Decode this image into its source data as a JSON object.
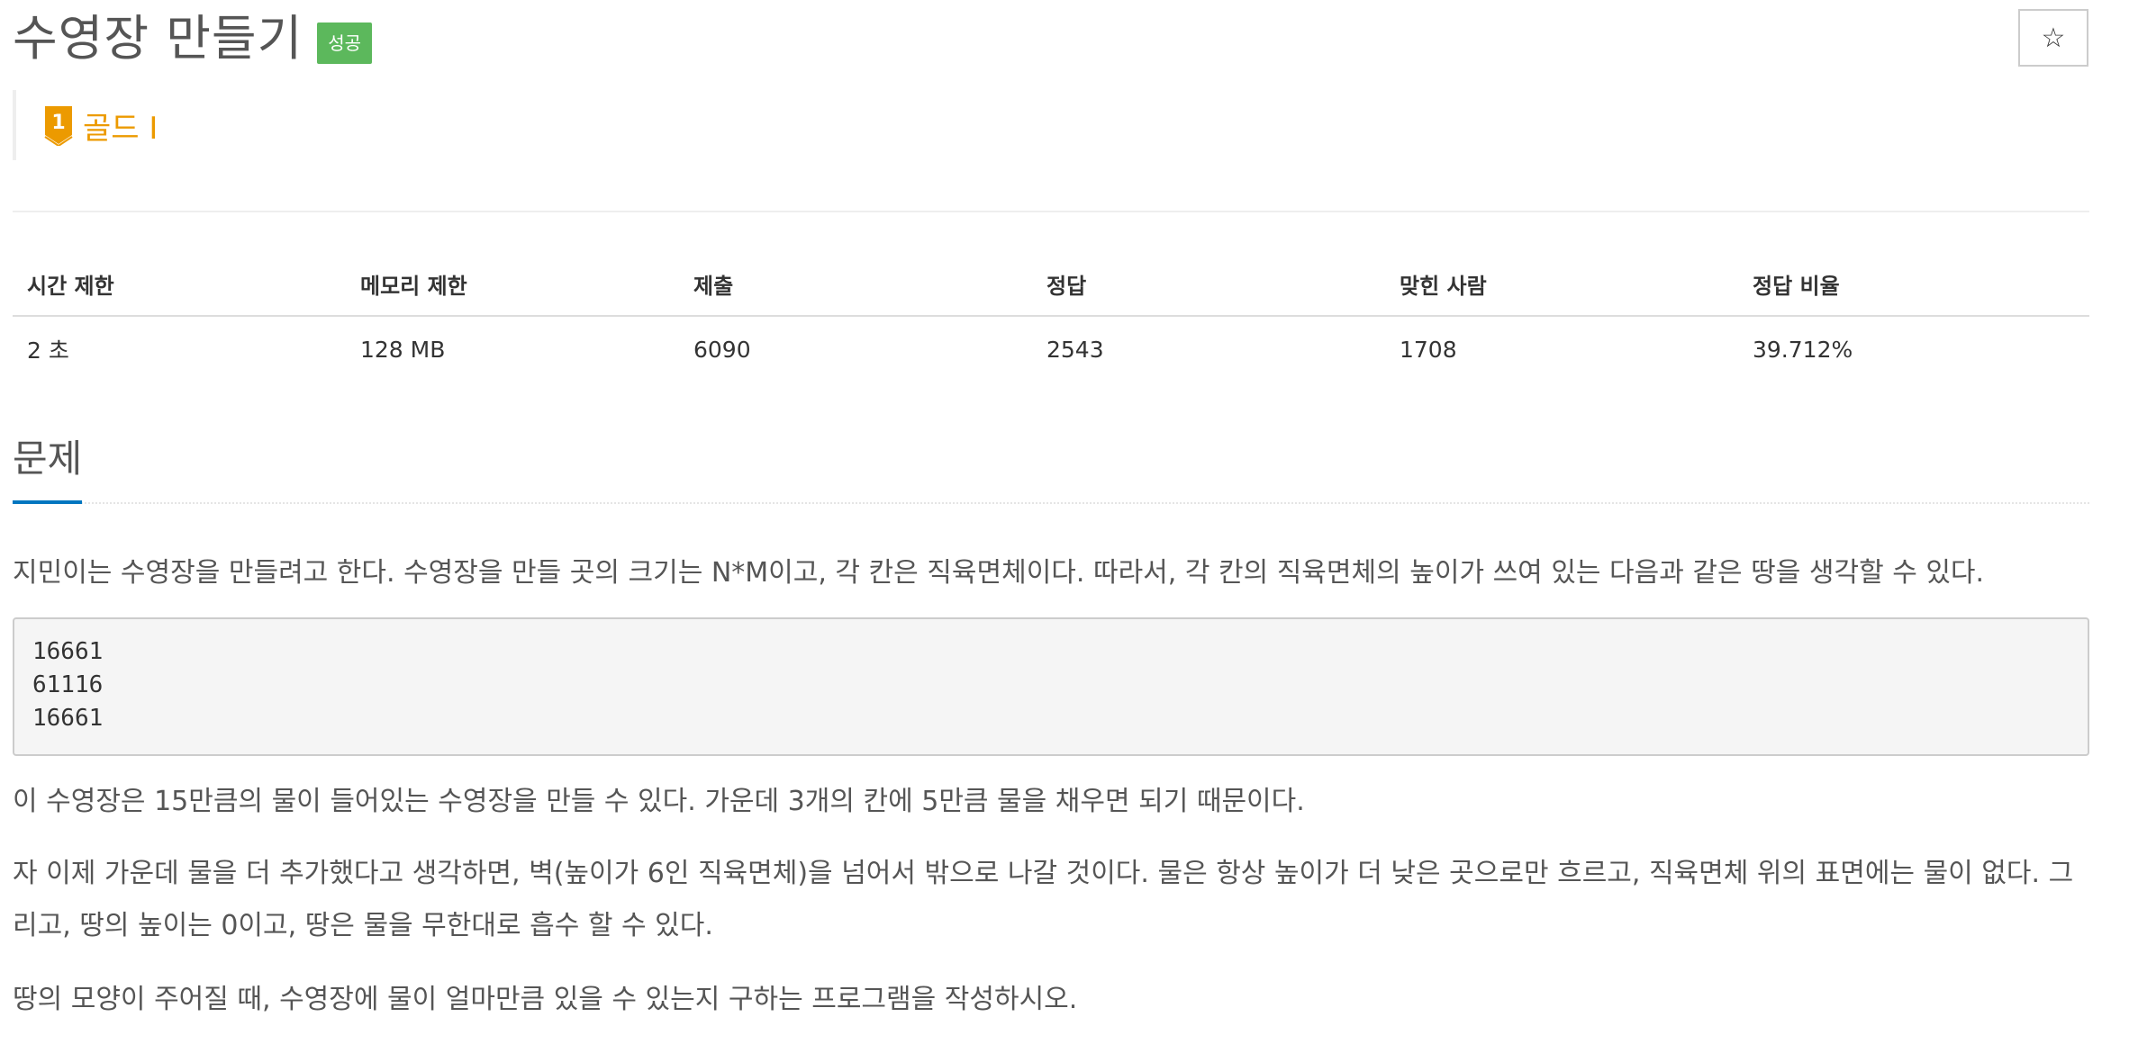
{
  "header": {
    "title": "수영장 만들기",
    "result_badge": "성공",
    "star_icon": "☆"
  },
  "tier": {
    "label": "골드 I",
    "level_number": "1",
    "color": "#ec9a00"
  },
  "stats": {
    "headers": [
      "시간 제한",
      "메모리 제한",
      "제출",
      "정답",
      "맞힌 사람",
      "정답 비율"
    ],
    "values": [
      "2 초",
      "128 MB",
      "6090",
      "2543",
      "1708",
      "39.712%"
    ]
  },
  "problem": {
    "section_title": "문제",
    "intro": "지민이는 수영장을 만들려고 한다. 수영장을 만들 곳의 크기는 N*M이고, 각 칸은 직육면체이다. 따라서, 각 칸의 직육면체의 높이가 쓰여 있는 다음과 같은 땅을 생각할 수 있다.",
    "example_lines": [
      "16661",
      "61116",
      "16661"
    ],
    "para2": "이 수영장은 15만큼의 물이 들어있는 수영장을 만들 수 있다. 가운데 3개의 칸에 5만큼 물을 채우면 되기 때문이다.",
    "para3": "자 이제 가운데 물을 더 추가했다고 생각하면, 벽(높이가 6인 직육면체)을 넘어서 밖으로 나갈 것이다. 물은 항상 높이가 더 낮은 곳으로만 흐르고, 직육면체 위의 표면에는 물이 없다. 그리고, 땅의 높이는 0이고, 땅은 물을 무한대로 흡수 할 수 있다.",
    "para4": "땅의 모양이 주어질 때, 수영장에 물이 얼마만큼 있을 수 있는지 구하는 프로그램을 작성하시오."
  },
  "colors": {
    "success": "#5cb85c",
    "gold": "#ec9a00",
    "section_underline": "#0076c0"
  }
}
